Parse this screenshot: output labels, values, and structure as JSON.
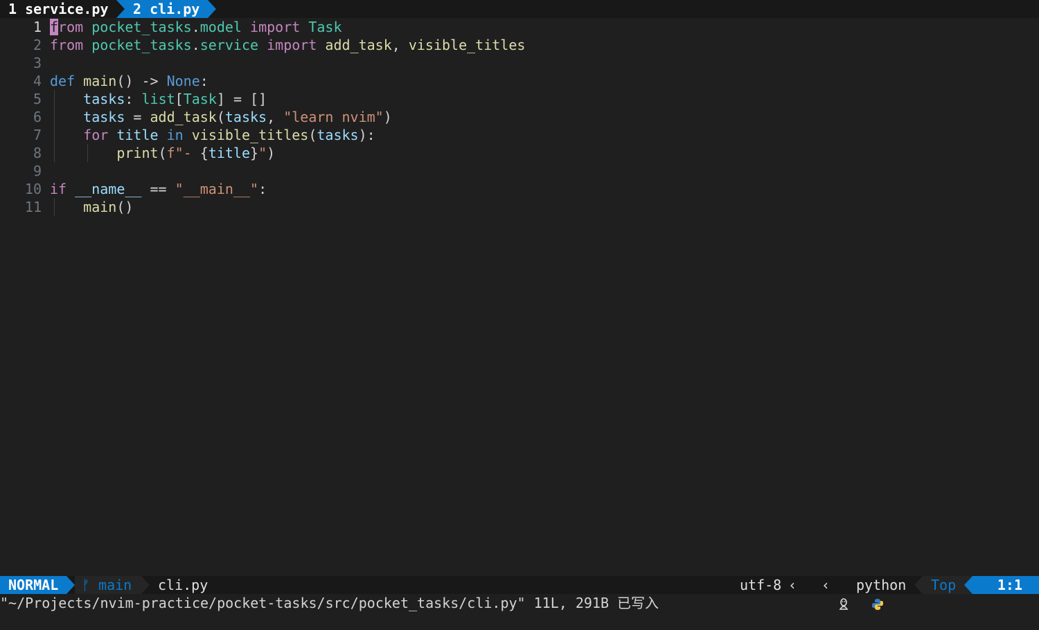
{
  "tabline": {
    "tabs": [
      {
        "label": "1 service.py",
        "active": false
      },
      {
        "label": "2 cli.py",
        "active": true
      }
    ]
  },
  "editor": {
    "line_numbers": [
      "1",
      "2",
      "3",
      "4",
      "5",
      "6",
      "7",
      "8",
      "9",
      "10",
      "11"
    ],
    "lines": [
      [
        {
          "t": "f",
          "c": "cursor"
        },
        {
          "t": "rom",
          "c": "kw"
        },
        {
          "t": " "
        },
        {
          "t": "pocket_tasks",
          "c": "mod"
        },
        {
          "t": "."
        },
        {
          "t": "model",
          "c": "mod"
        },
        {
          "t": " "
        },
        {
          "t": "import",
          "c": "kw"
        },
        {
          "t": " "
        },
        {
          "t": "Task",
          "c": "cls"
        }
      ],
      [
        {
          "t": "from",
          "c": "kw"
        },
        {
          "t": " "
        },
        {
          "t": "pocket_tasks",
          "c": "mod"
        },
        {
          "t": "."
        },
        {
          "t": "service",
          "c": "mod"
        },
        {
          "t": " "
        },
        {
          "t": "import",
          "c": "kw"
        },
        {
          "t": " "
        },
        {
          "t": "add_task",
          "c": "fn"
        },
        {
          "t": ", "
        },
        {
          "t": "visible_titles",
          "c": "fn"
        }
      ],
      [],
      [
        {
          "t": "def",
          "c": "kwb"
        },
        {
          "t": " "
        },
        {
          "t": "main",
          "c": "fn"
        },
        {
          "t": "() -> "
        },
        {
          "t": "None",
          "c": "kwb"
        },
        {
          "t": ":"
        }
      ],
      [
        {
          "t": "    "
        },
        {
          "t": "tasks",
          "c": "var"
        },
        {
          "t": ": "
        },
        {
          "t": "list",
          "c": "cls"
        },
        {
          "t": "["
        },
        {
          "t": "Task",
          "c": "cls"
        },
        {
          "t": "] = []"
        }
      ],
      [
        {
          "t": "    "
        },
        {
          "t": "tasks",
          "c": "var"
        },
        {
          "t": " = "
        },
        {
          "t": "add_task",
          "c": "fn"
        },
        {
          "t": "("
        },
        {
          "t": "tasks",
          "c": "var"
        },
        {
          "t": ", "
        },
        {
          "t": "\"learn nvim\"",
          "c": "str"
        },
        {
          "t": ")"
        }
      ],
      [
        {
          "t": "    "
        },
        {
          "t": "for",
          "c": "kw"
        },
        {
          "t": " "
        },
        {
          "t": "title",
          "c": "var"
        },
        {
          "t": " "
        },
        {
          "t": "in",
          "c": "kwb"
        },
        {
          "t": " "
        },
        {
          "t": "visible_titles",
          "c": "fn"
        },
        {
          "t": "("
        },
        {
          "t": "tasks",
          "c": "var"
        },
        {
          "t": "):"
        }
      ],
      [
        {
          "t": "        "
        },
        {
          "t": "print",
          "c": "fn"
        },
        {
          "t": "("
        },
        {
          "t": "f\"- ",
          "c": "str"
        },
        {
          "t": "{"
        },
        {
          "t": "title",
          "c": "var"
        },
        {
          "t": "}"
        },
        {
          "t": "\"",
          "c": "str"
        },
        {
          "t": ")"
        }
      ],
      [],
      [
        {
          "t": "if",
          "c": "kw"
        },
        {
          "t": " "
        },
        {
          "t": "__name__",
          "c": "var"
        },
        {
          "t": " == "
        },
        {
          "t": "\"__main__\"",
          "c": "str"
        },
        {
          "t": ":"
        }
      ],
      [
        {
          "t": "    "
        },
        {
          "t": "main",
          "c": "fn"
        },
        {
          "t": "()"
        }
      ]
    ]
  },
  "statusline": {
    "mode": "NORMAL",
    "branch_icon": "git-branch-icon",
    "branch": "main",
    "filename": "cli.py",
    "encoding": "utf-8",
    "os_icon": "linux-icon",
    "filetype_icon": "python-icon",
    "filetype": "python",
    "position": "Top",
    "location": "1:1"
  },
  "cmdline": {
    "message": "\"~/Projects/nvim-practice/pocket-tasks/src/pocket_tasks/cli.py\" 11L, 291B 已写入"
  },
  "colors": {
    "background": "#1f1f1f",
    "accent": "#0a7acd",
    "cursor": "#c586c0",
    "keyword": "#c586c0",
    "builtin": "#569cd6",
    "module": "#4ec9b0",
    "function": "#dcdcaa",
    "variable": "#9cdcfe",
    "string": "#ce9178"
  }
}
